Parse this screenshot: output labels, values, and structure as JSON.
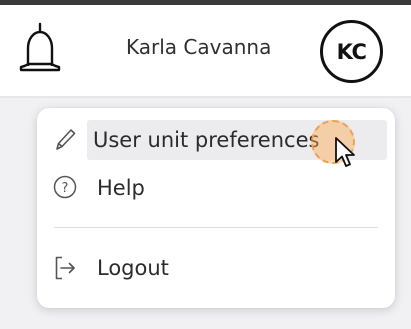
{
  "header": {
    "user_name": "Karla Cavanna",
    "avatar_initials": "KC",
    "bell_icon": "bell-icon"
  },
  "user_menu": {
    "items": [
      {
        "label": "User unit preferences",
        "icon": "pencil-icon",
        "state": "hovered"
      },
      {
        "label": "Help",
        "icon": "question-circle-icon"
      },
      {
        "label": "Logout",
        "icon": "logout-icon"
      }
    ]
  },
  "colors": {
    "hover_background": "#ececee",
    "page_background": "#f1f1f4",
    "click_indicator": "#f0a050"
  }
}
